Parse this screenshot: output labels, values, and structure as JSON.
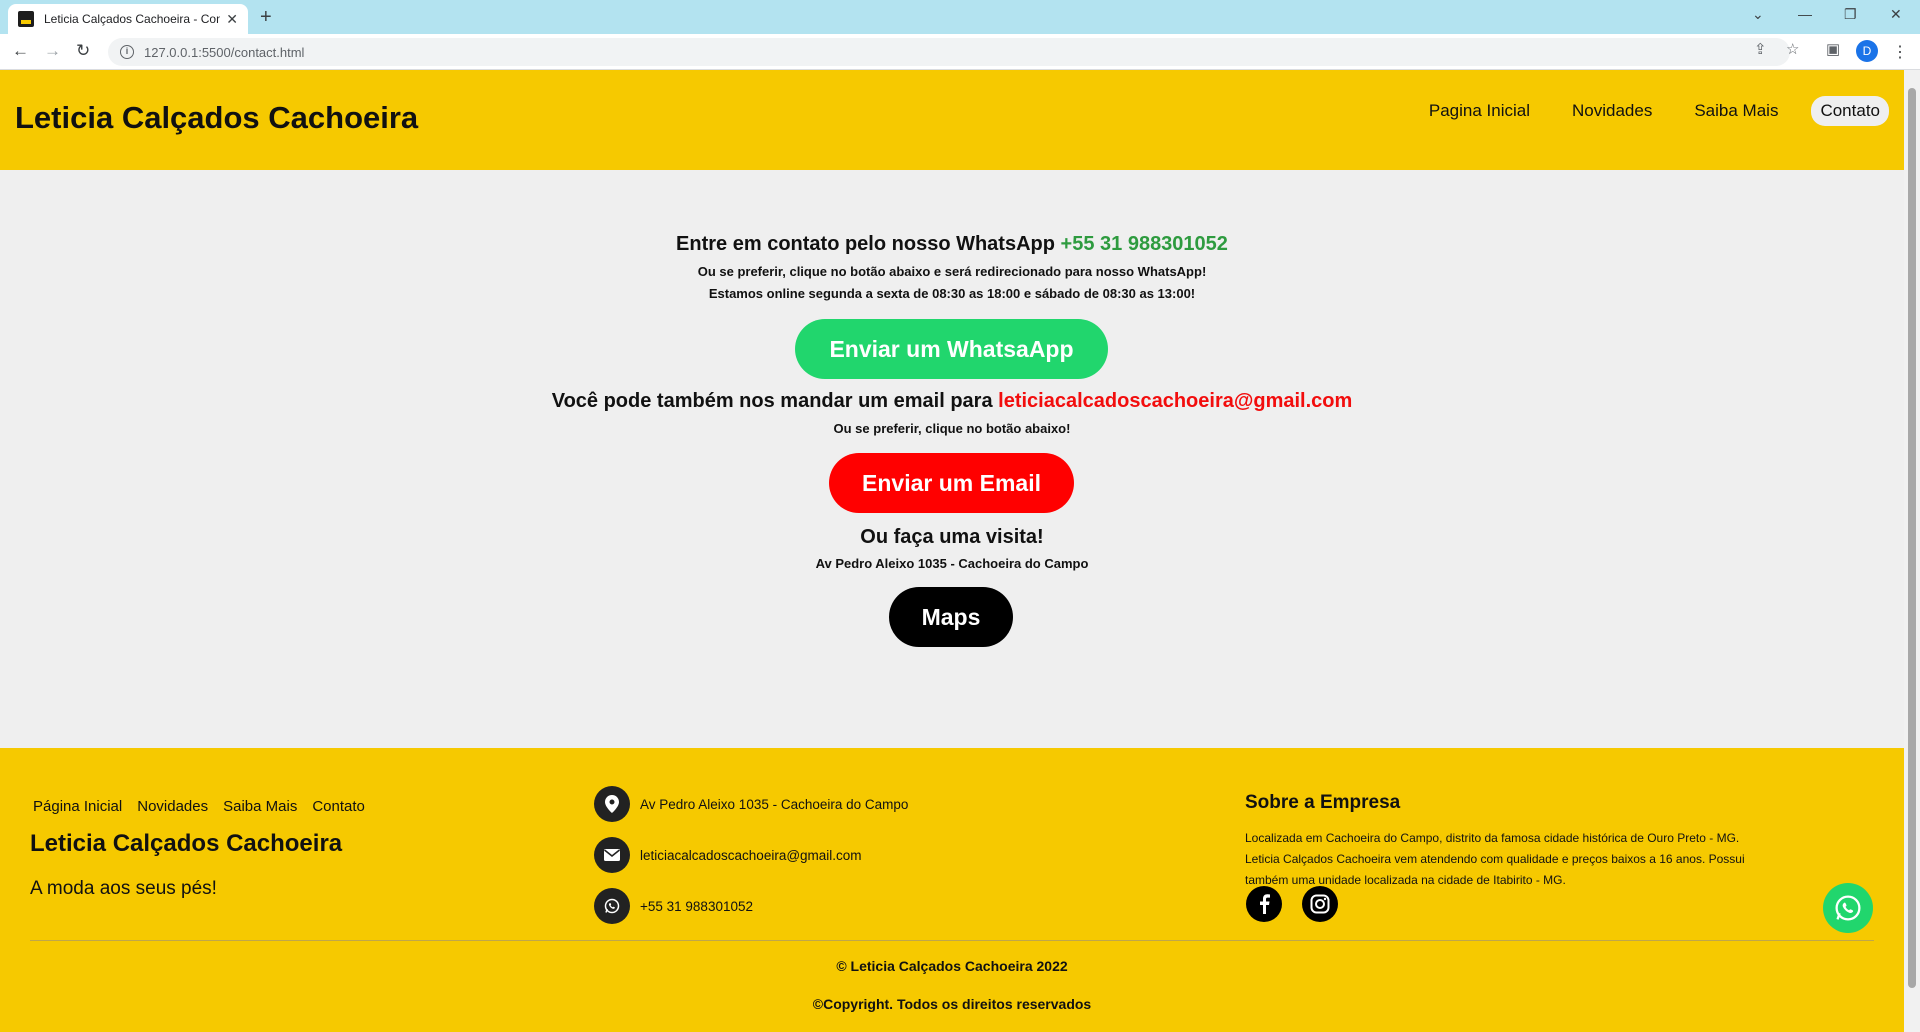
{
  "browser": {
    "tab_title": "Leticia Calçados Cachoeira - Contato",
    "url": "127.0.0.1:5500/contact.html",
    "profile_initial": "D"
  },
  "header": {
    "brand": "Leticia Calçados Cachoeira",
    "nav": [
      "Pagina Inicial",
      "Novidades",
      "Saiba Mais",
      "Contato"
    ],
    "active_nav": "Contato"
  },
  "contact": {
    "whatsapp_prefix": "Entre em contato pelo nosso WhatsApp ",
    "whatsapp_number": "+55 31 988301052",
    "whatsapp_line1": "Ou se preferir, clique no botão abaixo e será redirecionado para nosso WhatsApp!",
    "whatsapp_line2": "Estamos online segunda a sexta de 08:30 as 18:00 e sábado de 08:30 as 13:00!",
    "whatsapp_button": "Enviar um WhatsaApp",
    "email_prefix": "Você pode também nos mandar um email para ",
    "email_address": "leticiacalcadoscachoeira@gmail.com",
    "email_line": "Ou se preferir, clique no botão abaixo!",
    "email_button": "Enviar um Email",
    "visit_title": "Ou faça uma visita!",
    "visit_address": "Av Pedro Aleixo 1035 - Cachoeira do Campo",
    "maps_button": "Maps"
  },
  "footer": {
    "nav": [
      "Página Inicial",
      "Novidades",
      "Saiba Mais",
      "Contato"
    ],
    "brand": "Leticia Calçados Cachoeira",
    "tagline": "A moda aos seus pés!",
    "address": "Av Pedro Aleixo 1035 - Cachoeira do Campo",
    "email": "leticiacalcadoscachoeira@gmail.com",
    "phone": "+55 31 988301052",
    "about_title": "Sobre a Empresa",
    "about_text": "Localizada em Cachoeira do Campo, distrito da famosa cidade histórica de Ouro Preto - MG. Leticia Calçados Cachoeira vem atendendo com qualidade e preços baixos a 16 anos. Possui também uma unidade localizada na cidade de Itabirito - MG.",
    "copyright": "© Leticia Calçados Cachoeira 2022",
    "rights": "©Copyright. Todos os direitos reservados"
  },
  "icons": {
    "location": "map-pin-icon",
    "email": "envelope-icon",
    "phone": "whatsapp-icon",
    "facebook": "facebook-icon",
    "instagram": "instagram-icon"
  },
  "colors": {
    "brand_yellow": "#f6c900",
    "whatsapp_green": "#21d66d",
    "phone_green": "#2e9b3f",
    "email_red": "#f20d0d",
    "page_bg": "#efefef"
  }
}
